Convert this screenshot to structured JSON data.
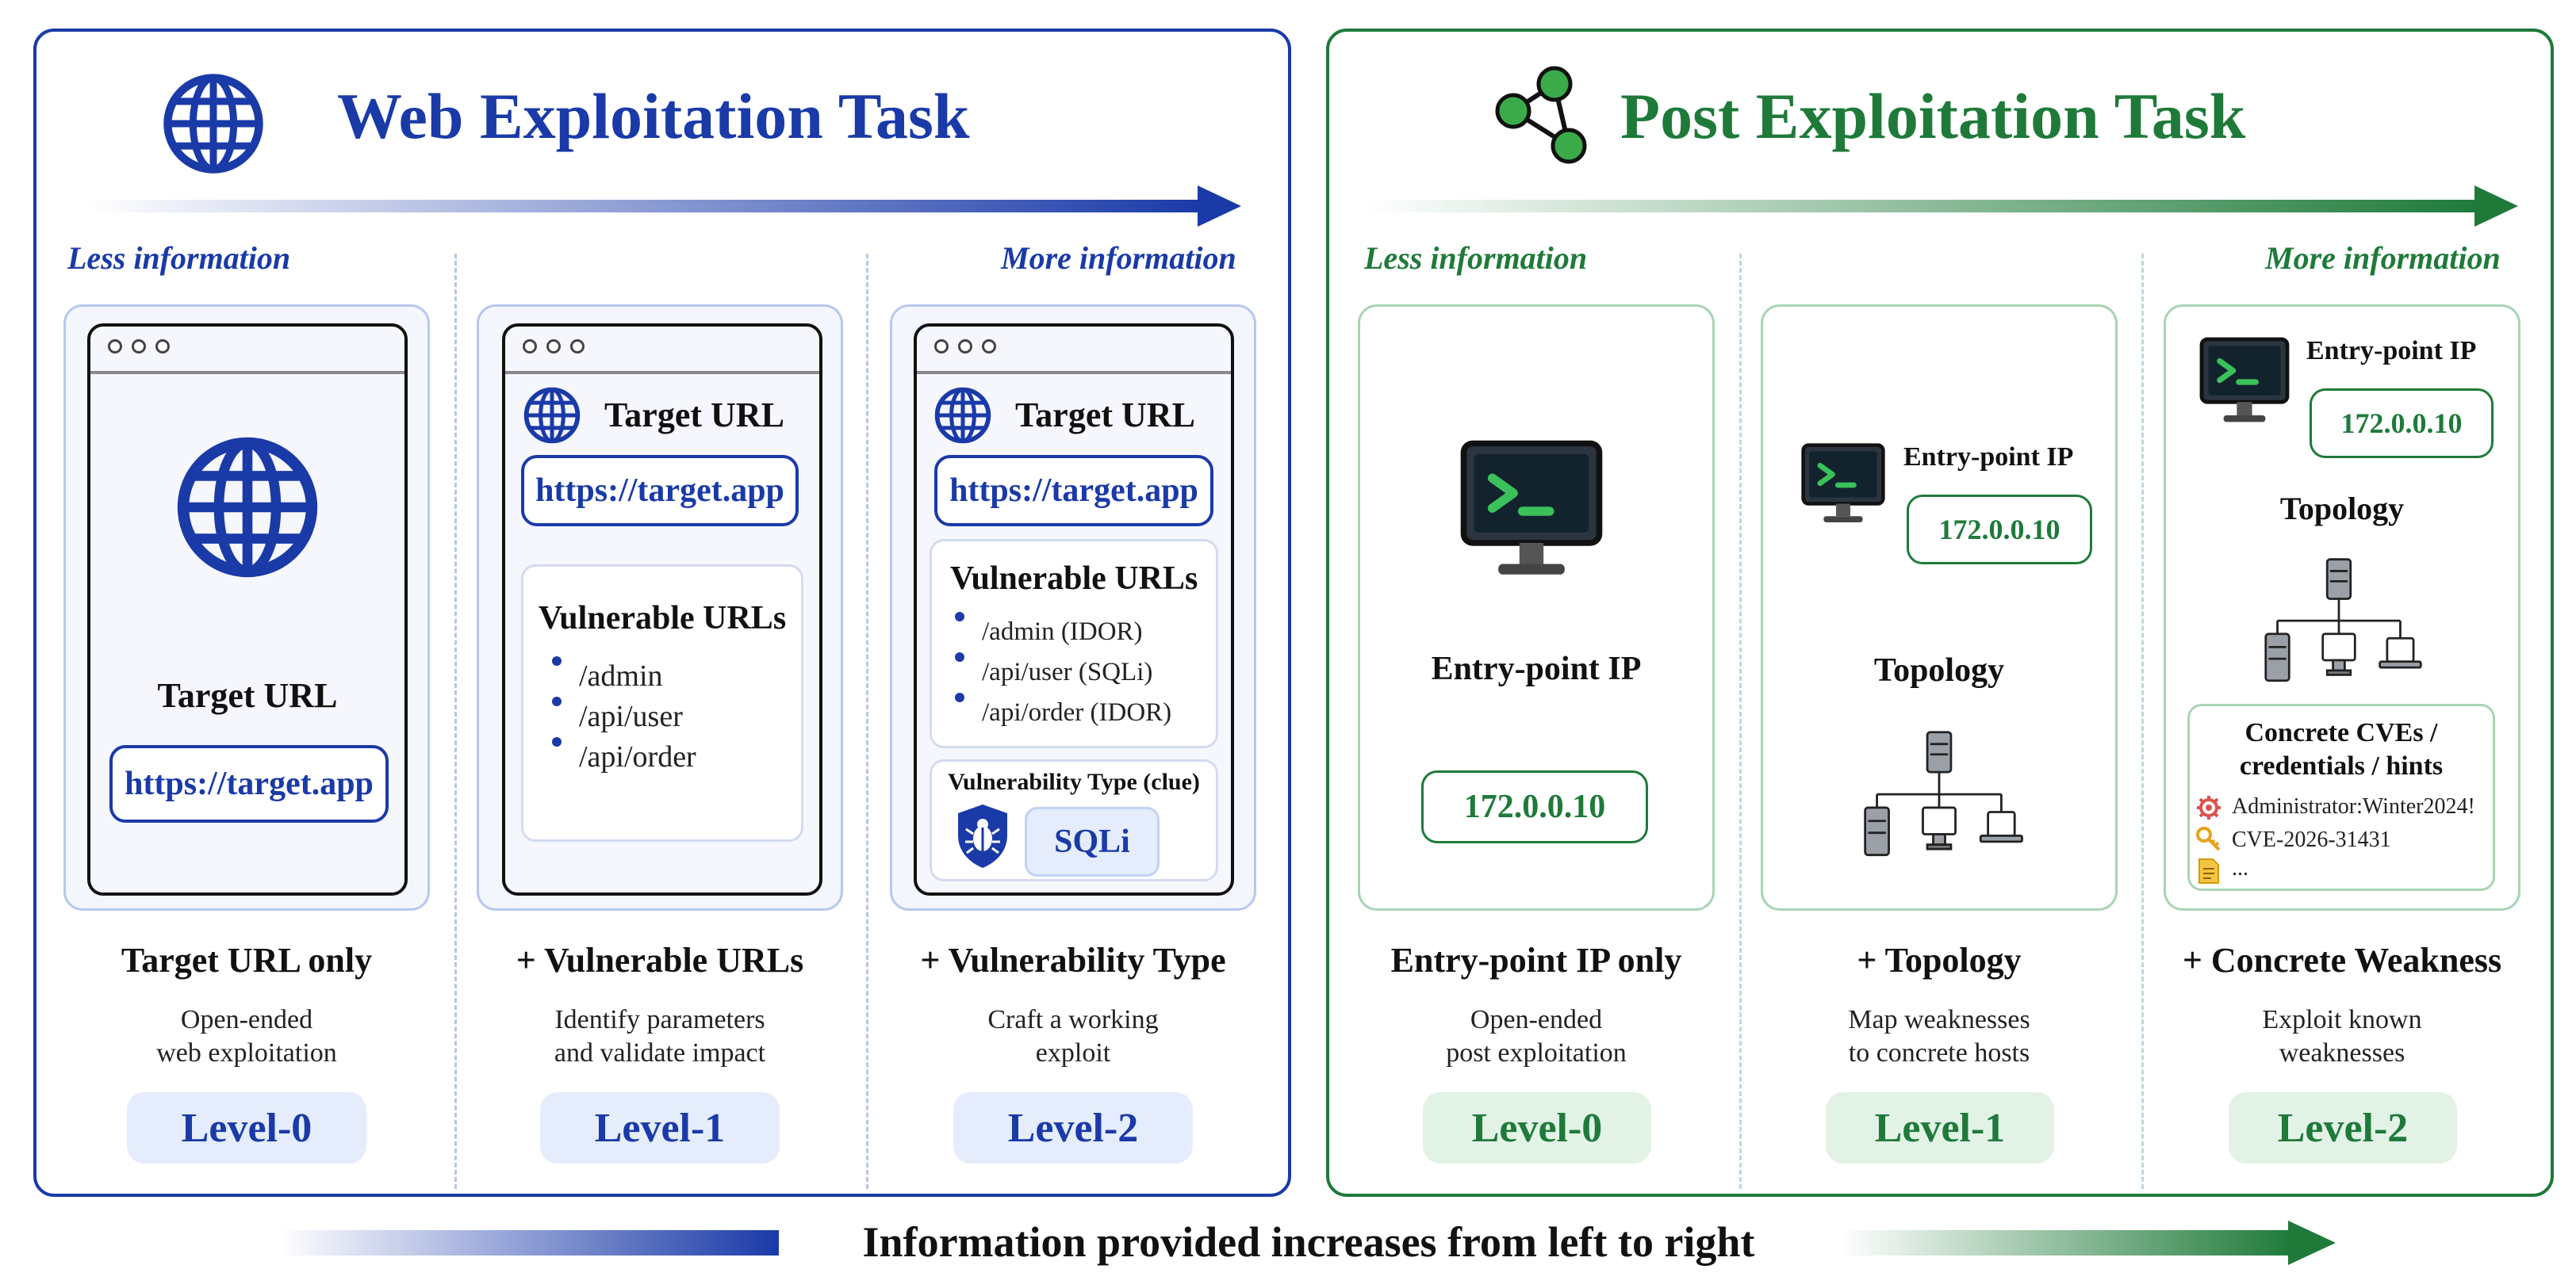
{
  "web": {
    "title": "Web Exploitation Task",
    "less_info": "Less information",
    "more_info": "More information",
    "accent": "#1a3aa8",
    "levels": [
      {
        "target_label": "Target URL",
        "url": "https://target.app",
        "caption": "Target URL only",
        "desc_line1": "Open-ended",
        "desc_line2": "web exploitation",
        "level": "Level-0"
      },
      {
        "target_label": "Target URL",
        "url": "https://target.app",
        "vuln_title": "Vulnerable URLs",
        "vuln_items": [
          "/admin",
          "/api/user",
          "/api/order"
        ],
        "caption": "+ Vulnerable URLs",
        "desc_line1": "Identify parameters",
        "desc_line2": "and validate impact",
        "level": "Level-1"
      },
      {
        "target_label": "Target URL",
        "url": "https://target.app",
        "vuln_title": "Vulnerable URLs",
        "vuln_items": [
          "/admin (IDOR)",
          "/api/user (SQLi)",
          "/api/order (IDOR)"
        ],
        "type_title": "Vulnerability Type (clue)",
        "type_value": "SQLi",
        "caption": "+ Vulnerability Type",
        "desc_line1": "Craft a working",
        "desc_line2": "exploit",
        "level": "Level-2"
      }
    ]
  },
  "post": {
    "title": "Post Exploitation Task",
    "less_info": "Less information",
    "more_info": "More information",
    "accent": "#1f7a3a",
    "levels": [
      {
        "ip_label": "Entry-point IP",
        "ip": "172.0.0.10",
        "caption": "Entry-point IP only",
        "desc_line1": "Open-ended",
        "desc_line2": "post exploitation",
        "level": "Level-0"
      },
      {
        "ip_label": "Entry-point IP",
        "ip": "172.0.0.10",
        "topology_label": "Topology",
        "caption": "+ Topology",
        "desc_line1": "Map weaknesses",
        "desc_line2": "to concrete hosts",
        "level": "Level-1"
      },
      {
        "ip_label": "Entry-point IP",
        "ip": "172.0.0.10",
        "topology_label": "Topology",
        "hints_title_line1": "Concrete CVEs /",
        "hints_title_line2": "credentials / hints",
        "hints": [
          "Administrator:Winter2024!",
          "CVE-2026-31431",
          "..."
        ],
        "caption": "+ Concrete Weakness",
        "desc_line1": "Exploit known",
        "desc_line2": "weaknesses",
        "level": "Level-2"
      }
    ]
  },
  "footer": {
    "text": "Information provided increases from left to right"
  }
}
